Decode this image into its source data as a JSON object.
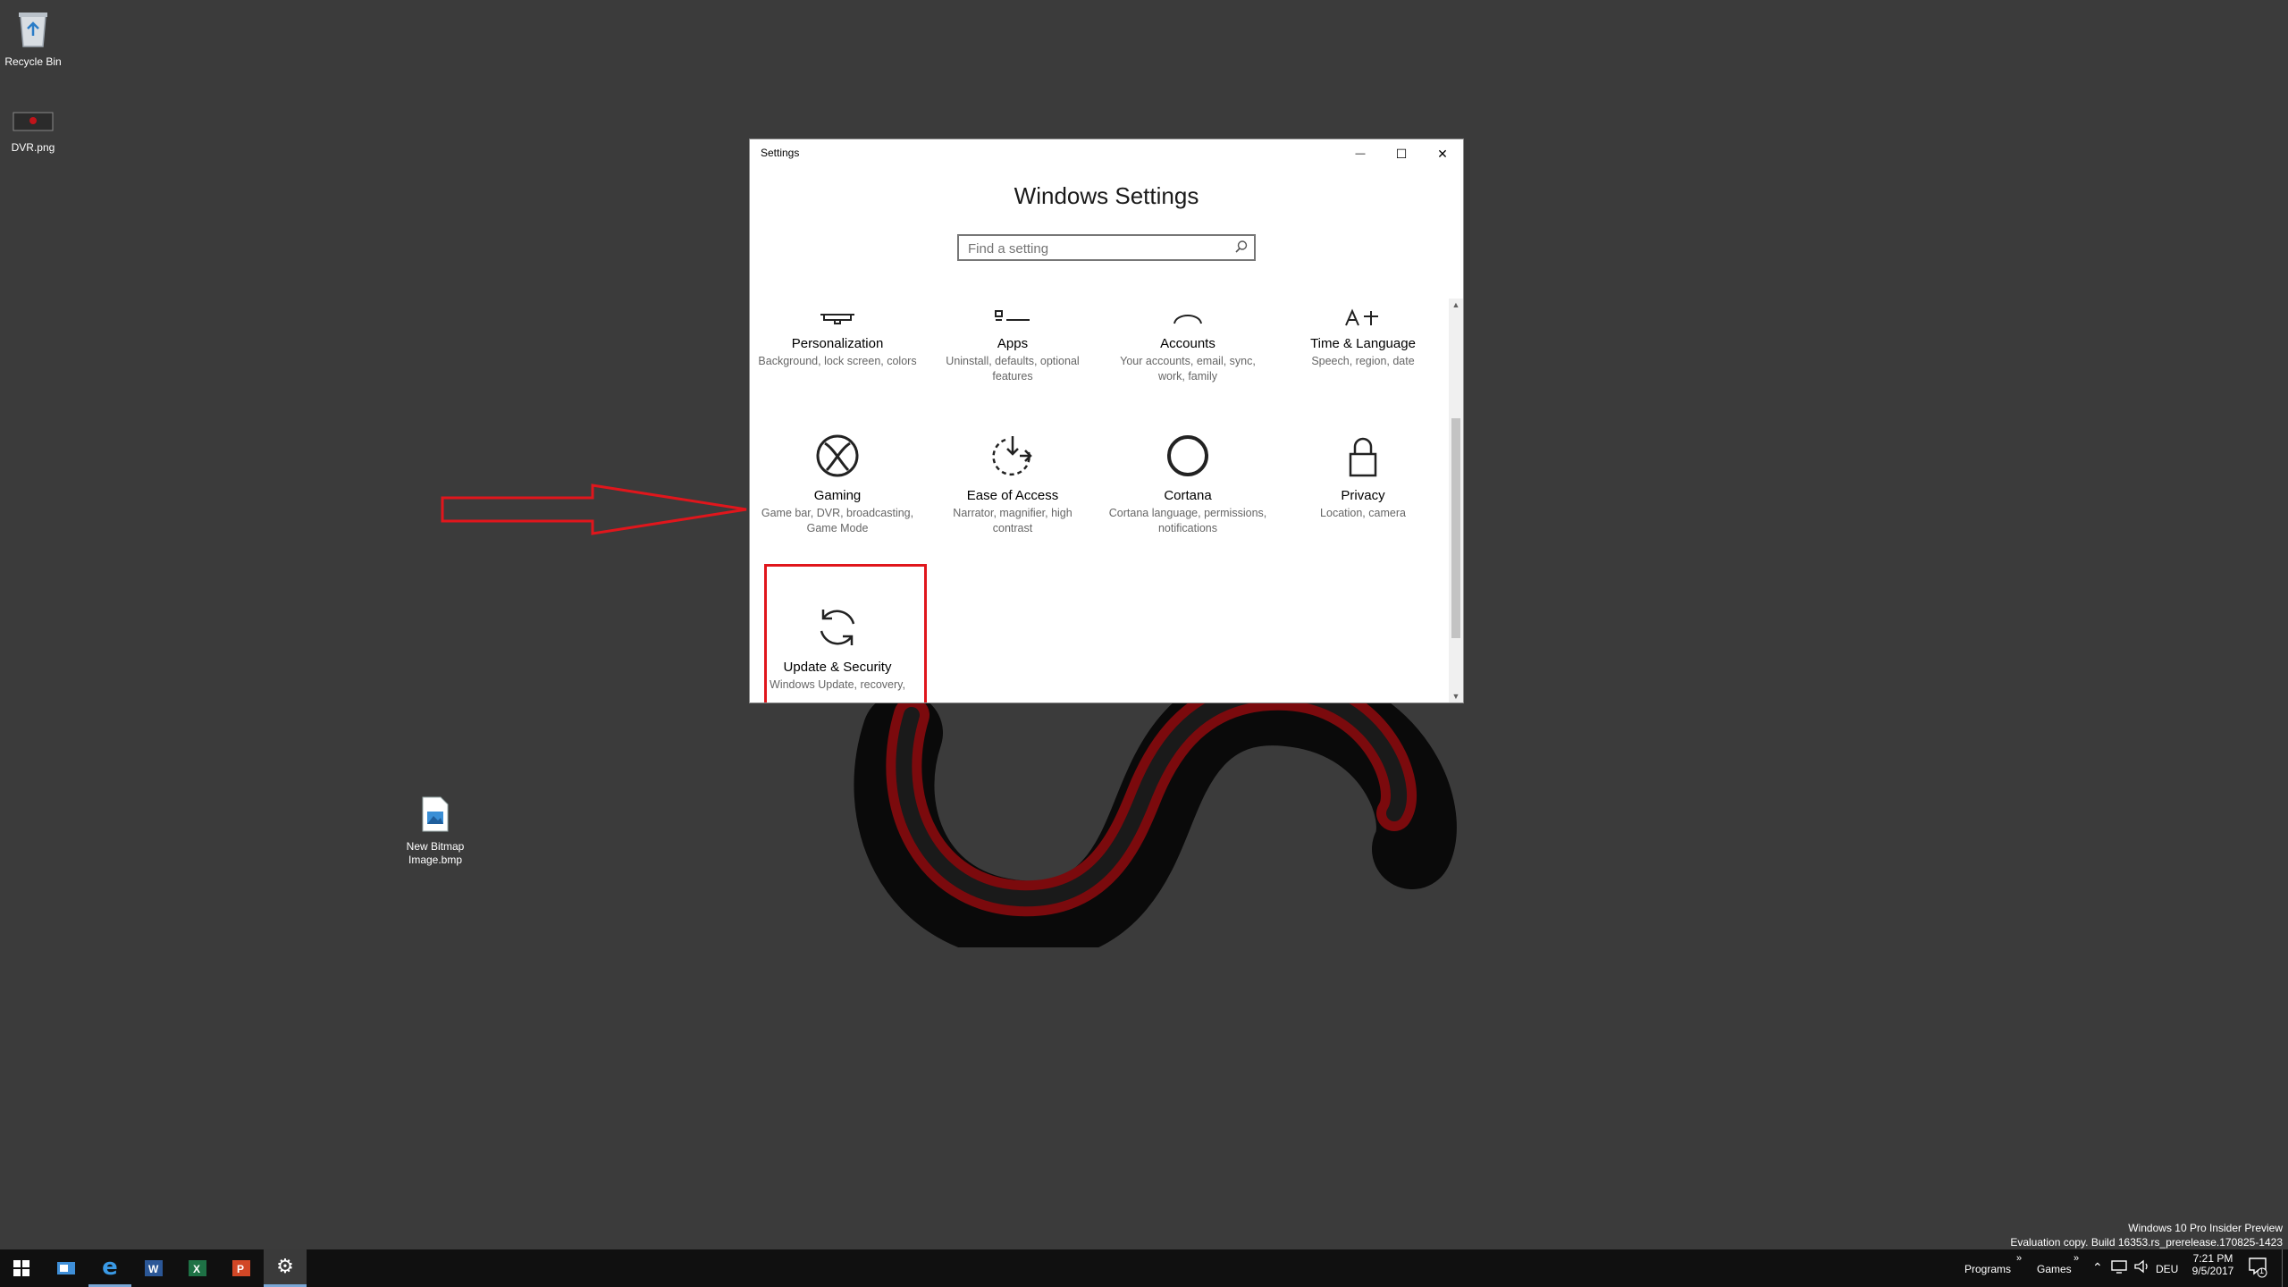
{
  "desktop": {
    "icons": [
      {
        "label": "Recycle Bin",
        "icon": "recycle-bin-icon"
      },
      {
        "label": "DVR.png",
        "icon": "image-file-icon"
      },
      {
        "label": "New Bitmap Image.bmp",
        "icon": "bitmap-file-icon"
      }
    ]
  },
  "window": {
    "title": "Settings",
    "heading": "Windows Settings",
    "search_placeholder": "Find a setting",
    "controls": {
      "minimize": "—",
      "maximize": "☐",
      "close": "✕"
    }
  },
  "tiles": [
    {
      "label": "Personalization",
      "desc": "Background, lock screen, colors",
      "icon": "personalization-icon"
    },
    {
      "label": "Apps",
      "desc": "Uninstall, defaults, optional features",
      "icon": "apps-icon"
    },
    {
      "label": "Accounts",
      "desc": "Your accounts, email, sync, work, family",
      "icon": "accounts-icon"
    },
    {
      "label": "Time & Language",
      "desc": "Speech, region, date",
      "icon": "time-language-icon"
    },
    {
      "label": "Gaming",
      "desc": "Game bar, DVR, broadcasting, Game Mode",
      "icon": "xbox-icon"
    },
    {
      "label": "Ease of Access",
      "desc": "Narrator, magnifier, high contrast",
      "icon": "ease-of-access-icon"
    },
    {
      "label": "Cortana",
      "desc": "Cortana language, permissions, notifications",
      "icon": "cortana-icon"
    },
    {
      "label": "Privacy",
      "desc": "Location, camera",
      "icon": "lock-icon"
    },
    {
      "label": "Update & Security",
      "desc": "Windows Update, recovery,",
      "icon": "sync-icon"
    }
  ],
  "taskbar": {
    "apps": [
      "start-icon",
      "outlook-icon",
      "edge-icon",
      "word-icon",
      "excel-icon",
      "powerpoint-icon",
      "settings-icon"
    ],
    "toolbar_programs": "Programs",
    "toolbar_games": "Games",
    "chevron": "»",
    "language": "DEU",
    "time": "7:21 PM",
    "date": "9/5/2017",
    "notification_count": "1"
  },
  "watermark": {
    "line1": "Windows 10 Pro Insider Preview",
    "line2": "Evaluation copy. Build 16353.rs_prerelease.170825-1423"
  },
  "colors": {
    "highlight": "#e0161c",
    "accent": "#0078d7"
  }
}
